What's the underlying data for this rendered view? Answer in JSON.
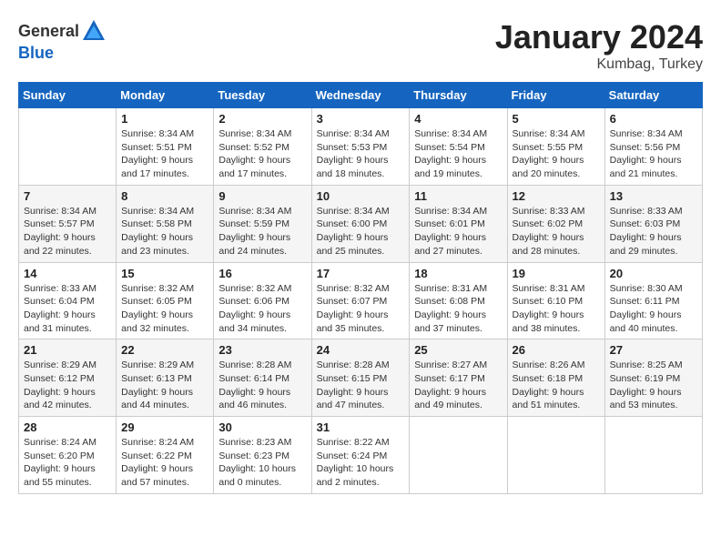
{
  "header": {
    "logo_general": "General",
    "logo_blue": "Blue",
    "month_title": "January 2024",
    "location": "Kumbag, Turkey"
  },
  "weekdays": [
    "Sunday",
    "Monday",
    "Tuesday",
    "Wednesday",
    "Thursday",
    "Friday",
    "Saturday"
  ],
  "weeks": [
    [
      {
        "day": "",
        "sunrise": "",
        "sunset": "",
        "daylight": ""
      },
      {
        "day": "1",
        "sunrise": "Sunrise: 8:34 AM",
        "sunset": "Sunset: 5:51 PM",
        "daylight": "Daylight: 9 hours and 17 minutes."
      },
      {
        "day": "2",
        "sunrise": "Sunrise: 8:34 AM",
        "sunset": "Sunset: 5:52 PM",
        "daylight": "Daylight: 9 hours and 17 minutes."
      },
      {
        "day": "3",
        "sunrise": "Sunrise: 8:34 AM",
        "sunset": "Sunset: 5:53 PM",
        "daylight": "Daylight: 9 hours and 18 minutes."
      },
      {
        "day": "4",
        "sunrise": "Sunrise: 8:34 AM",
        "sunset": "Sunset: 5:54 PM",
        "daylight": "Daylight: 9 hours and 19 minutes."
      },
      {
        "day": "5",
        "sunrise": "Sunrise: 8:34 AM",
        "sunset": "Sunset: 5:55 PM",
        "daylight": "Daylight: 9 hours and 20 minutes."
      },
      {
        "day": "6",
        "sunrise": "Sunrise: 8:34 AM",
        "sunset": "Sunset: 5:56 PM",
        "daylight": "Daylight: 9 hours and 21 minutes."
      }
    ],
    [
      {
        "day": "7",
        "sunrise": "Sunrise: 8:34 AM",
        "sunset": "Sunset: 5:57 PM",
        "daylight": "Daylight: 9 hours and 22 minutes."
      },
      {
        "day": "8",
        "sunrise": "Sunrise: 8:34 AM",
        "sunset": "Sunset: 5:58 PM",
        "daylight": "Daylight: 9 hours and 23 minutes."
      },
      {
        "day": "9",
        "sunrise": "Sunrise: 8:34 AM",
        "sunset": "Sunset: 5:59 PM",
        "daylight": "Daylight: 9 hours and 24 minutes."
      },
      {
        "day": "10",
        "sunrise": "Sunrise: 8:34 AM",
        "sunset": "Sunset: 6:00 PM",
        "daylight": "Daylight: 9 hours and 25 minutes."
      },
      {
        "day": "11",
        "sunrise": "Sunrise: 8:34 AM",
        "sunset": "Sunset: 6:01 PM",
        "daylight": "Daylight: 9 hours and 27 minutes."
      },
      {
        "day": "12",
        "sunrise": "Sunrise: 8:33 AM",
        "sunset": "Sunset: 6:02 PM",
        "daylight": "Daylight: 9 hours and 28 minutes."
      },
      {
        "day": "13",
        "sunrise": "Sunrise: 8:33 AM",
        "sunset": "Sunset: 6:03 PM",
        "daylight": "Daylight: 9 hours and 29 minutes."
      }
    ],
    [
      {
        "day": "14",
        "sunrise": "Sunrise: 8:33 AM",
        "sunset": "Sunset: 6:04 PM",
        "daylight": "Daylight: 9 hours and 31 minutes."
      },
      {
        "day": "15",
        "sunrise": "Sunrise: 8:32 AM",
        "sunset": "Sunset: 6:05 PM",
        "daylight": "Daylight: 9 hours and 32 minutes."
      },
      {
        "day": "16",
        "sunrise": "Sunrise: 8:32 AM",
        "sunset": "Sunset: 6:06 PM",
        "daylight": "Daylight: 9 hours and 34 minutes."
      },
      {
        "day": "17",
        "sunrise": "Sunrise: 8:32 AM",
        "sunset": "Sunset: 6:07 PM",
        "daylight": "Daylight: 9 hours and 35 minutes."
      },
      {
        "day": "18",
        "sunrise": "Sunrise: 8:31 AM",
        "sunset": "Sunset: 6:08 PM",
        "daylight": "Daylight: 9 hours and 37 minutes."
      },
      {
        "day": "19",
        "sunrise": "Sunrise: 8:31 AM",
        "sunset": "Sunset: 6:10 PM",
        "daylight": "Daylight: 9 hours and 38 minutes."
      },
      {
        "day": "20",
        "sunrise": "Sunrise: 8:30 AM",
        "sunset": "Sunset: 6:11 PM",
        "daylight": "Daylight: 9 hours and 40 minutes."
      }
    ],
    [
      {
        "day": "21",
        "sunrise": "Sunrise: 8:29 AM",
        "sunset": "Sunset: 6:12 PM",
        "daylight": "Daylight: 9 hours and 42 minutes."
      },
      {
        "day": "22",
        "sunrise": "Sunrise: 8:29 AM",
        "sunset": "Sunset: 6:13 PM",
        "daylight": "Daylight: 9 hours and 44 minutes."
      },
      {
        "day": "23",
        "sunrise": "Sunrise: 8:28 AM",
        "sunset": "Sunset: 6:14 PM",
        "daylight": "Daylight: 9 hours and 46 minutes."
      },
      {
        "day": "24",
        "sunrise": "Sunrise: 8:28 AM",
        "sunset": "Sunset: 6:15 PM",
        "daylight": "Daylight: 9 hours and 47 minutes."
      },
      {
        "day": "25",
        "sunrise": "Sunrise: 8:27 AM",
        "sunset": "Sunset: 6:17 PM",
        "daylight": "Daylight: 9 hours and 49 minutes."
      },
      {
        "day": "26",
        "sunrise": "Sunrise: 8:26 AM",
        "sunset": "Sunset: 6:18 PM",
        "daylight": "Daylight: 9 hours and 51 minutes."
      },
      {
        "day": "27",
        "sunrise": "Sunrise: 8:25 AM",
        "sunset": "Sunset: 6:19 PM",
        "daylight": "Daylight: 9 hours and 53 minutes."
      }
    ],
    [
      {
        "day": "28",
        "sunrise": "Sunrise: 8:24 AM",
        "sunset": "Sunset: 6:20 PM",
        "daylight": "Daylight: 9 hours and 55 minutes."
      },
      {
        "day": "29",
        "sunrise": "Sunrise: 8:24 AM",
        "sunset": "Sunset: 6:22 PM",
        "daylight": "Daylight: 9 hours and 57 minutes."
      },
      {
        "day": "30",
        "sunrise": "Sunrise: 8:23 AM",
        "sunset": "Sunset: 6:23 PM",
        "daylight": "Daylight: 10 hours and 0 minutes."
      },
      {
        "day": "31",
        "sunrise": "Sunrise: 8:22 AM",
        "sunset": "Sunset: 6:24 PM",
        "daylight": "Daylight: 10 hours and 2 minutes."
      },
      {
        "day": "",
        "sunrise": "",
        "sunset": "",
        "daylight": ""
      },
      {
        "day": "",
        "sunrise": "",
        "sunset": "",
        "daylight": ""
      },
      {
        "day": "",
        "sunrise": "",
        "sunset": "",
        "daylight": ""
      }
    ]
  ]
}
